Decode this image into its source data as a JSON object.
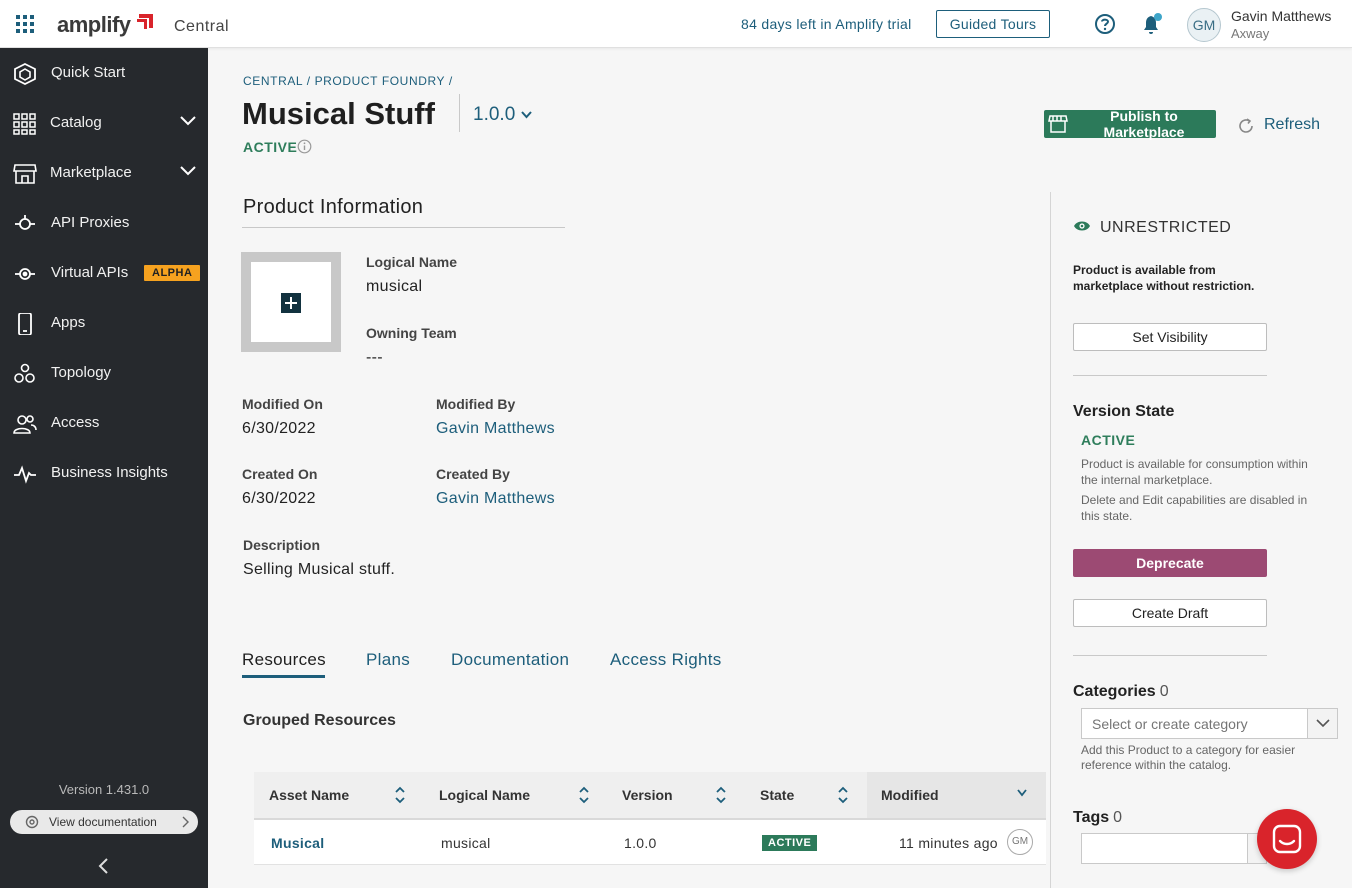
{
  "topbar": {
    "brand": "amplify",
    "app_name": "Central",
    "trial_text": "84 days left in Amplify trial",
    "tours_label": "Guided Tours",
    "user_initials": "GM",
    "user_name": "Gavin Matthews",
    "user_org": "Axway"
  },
  "sidebar": {
    "items": [
      {
        "label": "Quick Start",
        "icon": "hexagon-icon"
      },
      {
        "label": "Catalog",
        "icon": "grid-icon",
        "expandable": true
      },
      {
        "label": "Marketplace",
        "icon": "storefront-icon",
        "expandable": true
      },
      {
        "label": "API Proxies",
        "icon": "proxy-icon"
      },
      {
        "label": "Virtual APIs",
        "icon": "virtual-api-icon",
        "badge": "ALPHA"
      },
      {
        "label": "Apps",
        "icon": "phone-icon"
      },
      {
        "label": "Topology",
        "icon": "topology-icon"
      },
      {
        "label": "Access",
        "icon": "users-icon"
      },
      {
        "label": "Business Insights",
        "icon": "pulse-icon"
      }
    ],
    "version": "Version 1.431.0",
    "doc_label": "View documentation"
  },
  "header": {
    "breadcrumb": "CENTRAL / PRODUCT FOUNDRY /",
    "title": "Musical Stuff",
    "version": "1.0.0",
    "status": "ACTIVE",
    "publish_label": "Publish to Marketplace",
    "refresh_label": "Refresh"
  },
  "product_info": {
    "section_title": "Product Information",
    "logical_name_label": "Logical Name",
    "logical_name": "musical",
    "owning_team_label": "Owning Team",
    "owning_team": "---",
    "modified_on_label": "Modified On",
    "modified_on": "6/30/2022",
    "modified_by_label": "Modified By",
    "modified_by": "Gavin Matthews",
    "created_on_label": "Created On",
    "created_on": "6/30/2022",
    "created_by_label": "Created By",
    "created_by": "Gavin Matthews",
    "description_label": "Description",
    "description": "Selling Musical stuff."
  },
  "tabs": [
    {
      "label": "Resources",
      "active": true
    },
    {
      "label": "Plans"
    },
    {
      "label": "Documentation"
    },
    {
      "label": "Access Rights"
    }
  ],
  "resources": {
    "title": "Grouped Resources",
    "columns": [
      "Asset Name",
      "Logical Name",
      "Version",
      "State",
      "Modified"
    ],
    "rows": [
      {
        "asset_name": "Musical",
        "logical_name": "musical",
        "version": "1.0.0",
        "state": "ACTIVE",
        "modified": "11 minutes ago",
        "owner_initials": "GM"
      }
    ]
  },
  "right_panel": {
    "visibility": "UNRESTRICTED",
    "visibility_desc": "Product is available from marketplace without restriction.",
    "set_visibility_label": "Set Visibility",
    "version_state_title": "Version State",
    "version_state": "ACTIVE",
    "version_desc_1": "Product is available for consumption within the internal marketplace.",
    "version_desc_2": "Delete and Edit capabilities are disabled in this state.",
    "deprecate_label": "Deprecate",
    "create_draft_label": "Create Draft",
    "categories_title": "Categories",
    "categories_count": "0",
    "category_placeholder": "Select or create category",
    "category_hint": "Add this Product to a category for easier reference within the catalog.",
    "tags_title": "Tags",
    "tags_count": "0"
  },
  "colors": {
    "accent": "#1d5e7b",
    "active_green": "#2c7a5a",
    "deprecate": "#9c4a73",
    "sidebar_bg": "#26292d",
    "alpha_badge": "#f6a21f",
    "chat": "#d9242b"
  }
}
